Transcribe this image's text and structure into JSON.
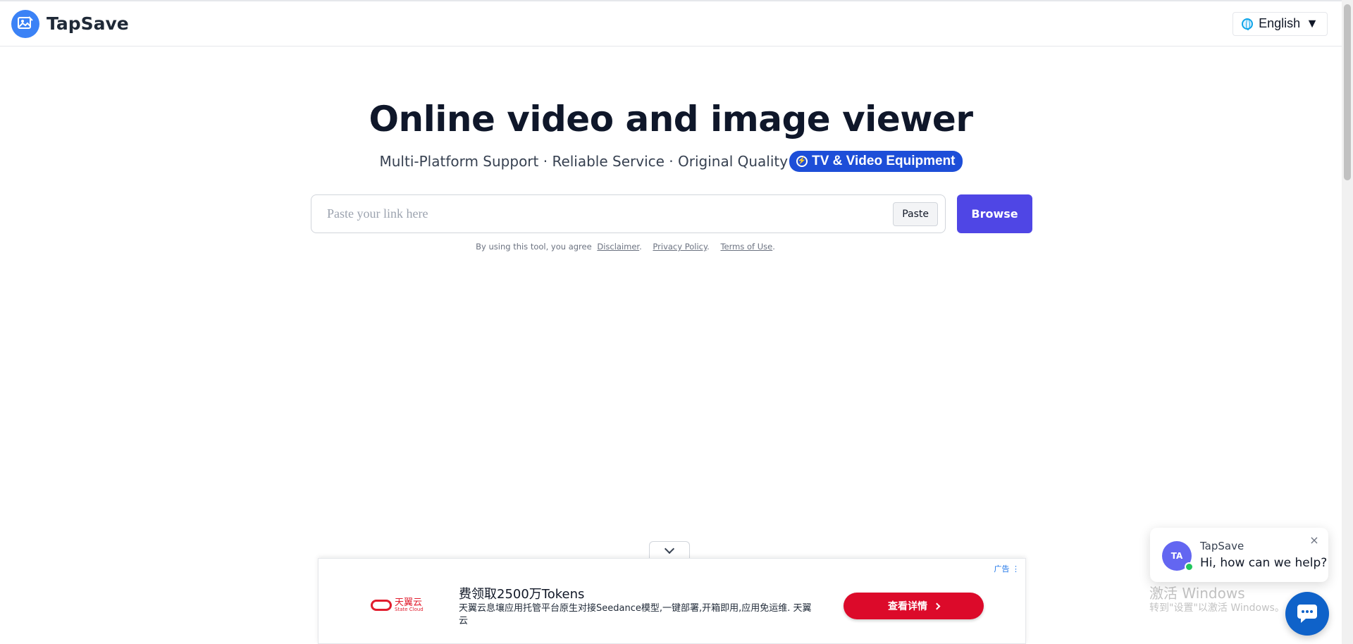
{
  "header": {
    "brand_name": "TapSave",
    "language": "English",
    "language_caret": "▼"
  },
  "hero": {
    "title": "Online video and image viewer",
    "subtitle": "Multi-Platform Support · Reliable Service · Original Quality",
    "badge": "TV & Video Equipment"
  },
  "search": {
    "placeholder": "Paste your link here",
    "value": "",
    "paste_label": "Paste",
    "browse_label": "Browse"
  },
  "agreement": {
    "prefix": "By using this tool, you agree",
    "disclaimer": "Disclaimer",
    "privacy": "Privacy Policy",
    "terms": "Terms of Use",
    "sep1": ".",
    "sep2": ".",
    "sep3": "."
  },
  "ad": {
    "label": "广告 ⋮",
    "logo_text": "天翼云",
    "logo_sub": "State Cloud",
    "title": "费领取2500万Tokens",
    "description": "天翼云息壤应用托管平台原生对接Seedance模型,一键部署,开箱即用,应用免运维. 天翼云",
    "cta": "查看详情"
  },
  "watermark": {
    "line1": "激活 Windows",
    "line2": "转到\"设置\"以激活 Windows。"
  },
  "chat": {
    "avatar_initials": "TA",
    "name": "TapSave",
    "message": "Hi, how can we help?",
    "close": "×"
  },
  "colors": {
    "accent": "#4f46e5",
    "badge": "#1d4ed8",
    "ad_cta": "#dc0a2a",
    "chat_launcher": "#0f62c9"
  }
}
